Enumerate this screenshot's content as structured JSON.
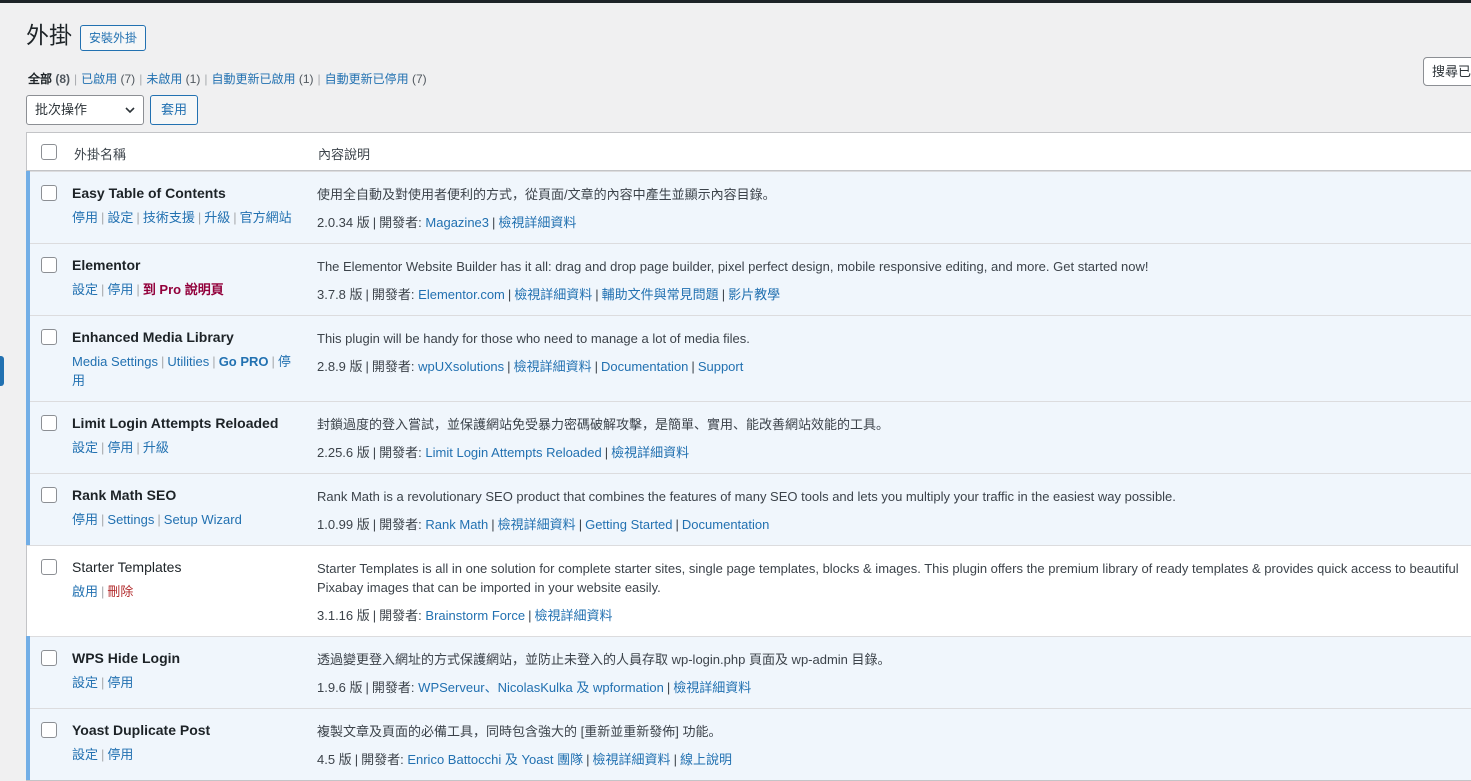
{
  "page": {
    "title": "外掛",
    "add_new": "安裝外掛"
  },
  "filters": [
    {
      "label": "全部",
      "count": "(8)"
    },
    {
      "label": "已啟用",
      "count": "(7)"
    },
    {
      "label": "未啟用",
      "count": "(1)"
    },
    {
      "label": "自動更新已啟用",
      "count": "(1)"
    },
    {
      "label": "自動更新已停用",
      "count": "(7)"
    }
  ],
  "search": {
    "button": "搜尋已"
  },
  "bulk": {
    "selected": "批次操作",
    "apply": "套用"
  },
  "table": {
    "col_name": "外掛名稱",
    "col_desc": "內容說明"
  },
  "plugins": [
    {
      "name": "Easy Table of Contents",
      "actions": [
        "停用",
        "設定",
        "技術支援",
        "升級",
        "官方網站"
      ],
      "description": "使用全自動及對使用者便利的方式，從頁面/文章的內容中產生並顯示內容目錄。",
      "version": "2.0.34 版",
      "dev_label": "開發者:",
      "author": "Magazine3",
      "links": [
        "檢視詳細資料"
      ]
    },
    {
      "name": "Elementor",
      "actions": [
        "設定",
        "停用"
      ],
      "pro_red": "到 Pro 說明頁",
      "description": "The Elementor Website Builder has it all: drag and drop page builder, pixel perfect design, mobile responsive editing, and more. Get started now!",
      "version": "3.7.8 版",
      "dev_label": "開發者:",
      "author": "Elementor.com",
      "links": [
        "檢視詳細資料",
        "輔助文件與常見問題",
        "影片教學"
      ]
    },
    {
      "name": "Enhanced Media Library",
      "actions": [
        "Media Settings",
        "Utilities"
      ],
      "pro_blue": "Go PRO",
      "action_last": "停用",
      "description": "This plugin will be handy for those who need to manage a lot of media files.",
      "version": "2.8.9 版",
      "dev_label": "開發者:",
      "author": "wpUXsolutions",
      "links": [
        "檢視詳細資料",
        "Documentation",
        "Support"
      ]
    },
    {
      "name": "Limit Login Attempts Reloaded",
      "actions": [
        "設定",
        "停用",
        "升級"
      ],
      "description": "封鎖過度的登入嘗試，並保護網站免受暴力密碼破解攻擊，是簡單、實用、能改善網站效能的工具。",
      "version": "2.25.6 版",
      "dev_label": "開發者:",
      "author": "Limit Login Attempts Reloaded",
      "links": [
        "檢視詳細資料"
      ]
    },
    {
      "name": "Rank Math SEO",
      "actions": [
        "停用",
        "Settings",
        "Setup Wizard"
      ],
      "description": "Rank Math is a revolutionary SEO product that combines the features of many SEO tools and lets you multiply your traffic in the easiest way possible.",
      "version": "1.0.99 版",
      "dev_label": "開發者:",
      "author": "Rank Math",
      "links": [
        "檢視詳細資料",
        "Getting Started",
        "Documentation"
      ]
    },
    {
      "name": "Starter Templates",
      "actions": [
        "啟用"
      ],
      "action_delete": "刪除",
      "description": "Starter Templates is all in one solution for complete starter sites, single page templates, blocks & images. This plugin offers the premium library of ready templates & provides quick access to beautiful Pixabay images that can be imported in your website easily.",
      "version": "3.1.16 版",
      "dev_label": "開發者:",
      "author": "Brainstorm Force",
      "links": [
        "檢視詳細資料"
      ]
    },
    {
      "name": "WPS Hide Login",
      "actions": [
        "設定",
        "停用"
      ],
      "description": "透過變更登入網址的方式保護網站，並防止未登入的人員存取 wp-login.php 頁面及 wp-admin 目錄。",
      "version": "1.9.6 版",
      "dev_label": "開發者:",
      "author": "WPServeur、NicolasKulka 及 wpformation",
      "links": [
        "檢視詳細資料"
      ]
    },
    {
      "name": "Yoast Duplicate Post",
      "actions": [
        "設定",
        "停用"
      ],
      "description": "複製文章及頁面的必備工具，同時包含強大的 [重新並重新發佈] 功能。",
      "version": "4.5 版",
      "dev_label": "開發者:",
      "author": "Enrico Battocchi 及 Yoast 團隊",
      "links": [
        "檢視詳細資料",
        "線上說明"
      ]
    }
  ],
  "colors": {
    "accent": "#2271b1",
    "active_row": "#f0f6fc",
    "active_bar": "#72aee6",
    "delete": "#b32d2e"
  }
}
